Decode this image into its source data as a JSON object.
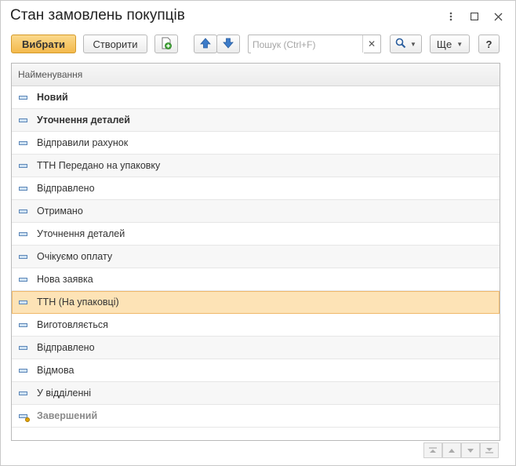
{
  "window": {
    "title": "Стан замовлень покупців"
  },
  "toolbar": {
    "select_label": "Вибрати",
    "create_label": "Створити",
    "search_placeholder": "Пошук (Ctrl+F)",
    "more_label": "Ще",
    "help_label": "?"
  },
  "list": {
    "header": "Найменування",
    "rows": [
      {
        "label": "Новий",
        "style": "bold"
      },
      {
        "label": "Уточнення деталей",
        "style": "bold"
      },
      {
        "label": "Відправили рахунок",
        "style": "normal"
      },
      {
        "label": "ТТН Передано на упаковку",
        "style": "normal"
      },
      {
        "label": "Відправлено",
        "style": "normal"
      },
      {
        "label": "Отримано",
        "style": "normal"
      },
      {
        "label": "Уточнення деталей",
        "style": "normal"
      },
      {
        "label": "Очікуємо оплату",
        "style": "normal"
      },
      {
        "label": "Нова заявка",
        "style": "normal"
      },
      {
        "label": "ТТН (На упаковці)",
        "style": "selected"
      },
      {
        "label": "Виготовляється",
        "style": "normal"
      },
      {
        "label": "Відправлено",
        "style": "normal"
      },
      {
        "label": "Відмова",
        "style": "normal"
      },
      {
        "label": "У відділенні",
        "style": "normal"
      },
      {
        "label": "Завершений",
        "style": "disabled"
      }
    ]
  },
  "colors": {
    "accent": "#f3b94c",
    "selection": "#fde3b6",
    "icon_blue": "#3d7cc9"
  },
  "icons": [
    "more-vertical-icon",
    "maximize-icon",
    "close-icon",
    "add-copy-icon",
    "arrow-up-icon",
    "arrow-down-icon",
    "search-icon",
    "clear-icon",
    "chevron-down-icon",
    "list-item-icon",
    "marked-item-icon",
    "scroll-top-icon",
    "scroll-up-icon",
    "scroll-down-icon",
    "scroll-bottom-icon"
  ]
}
